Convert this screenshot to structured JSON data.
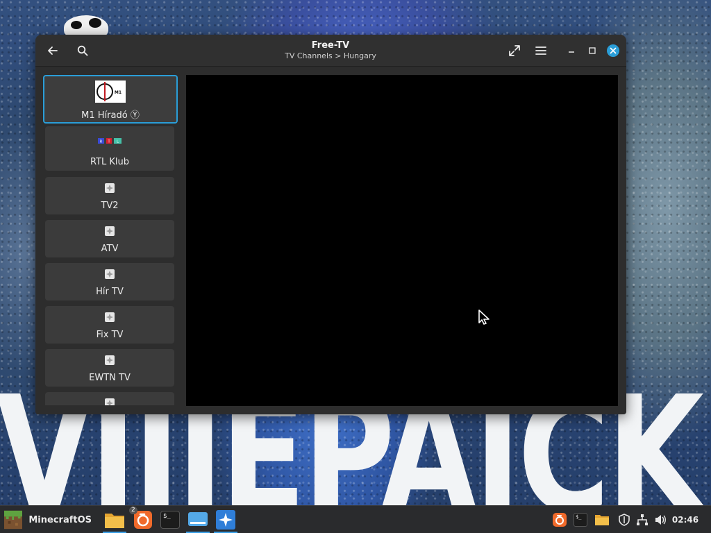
{
  "wallpaper": {
    "big_text": "VIIIEPAICK"
  },
  "window": {
    "title": "Free-TV",
    "subtitle": "TV Channels > Hungary"
  },
  "channels": [
    {
      "name": "M1 Híradó Ⓨ",
      "logo": "m1-logo",
      "logo_text": "M1",
      "selected": true
    },
    {
      "name": "RTL Klub",
      "logo": "rtl-logo",
      "logo_letters": [
        "R",
        "T",
        "L"
      ],
      "logo_colors": [
        "#3b4bd6",
        "#d8202f",
        "#45c0a8"
      ]
    },
    {
      "name": "TV2",
      "logo": "placeholder-tv-icon"
    },
    {
      "name": "ATV",
      "logo": "placeholder-tv-icon"
    },
    {
      "name": "Hír TV",
      "logo": "placeholder-tv-icon"
    },
    {
      "name": "Fix TV",
      "logo": "placeholder-tv-icon"
    },
    {
      "name": "EWTN TV",
      "logo": "placeholder-tv-icon"
    },
    {
      "name": "",
      "logo": "placeholder-tv-icon"
    }
  ],
  "taskbar": {
    "start_label": "MinecraftOS",
    "firefox_badge": "2",
    "terminal_glyph": "$_",
    "clock": "02:46"
  },
  "colors": {
    "accent": "#2a9ed8",
    "window_bg": "#2d2d2d",
    "taskbar_bg": "#2a2b2d"
  }
}
